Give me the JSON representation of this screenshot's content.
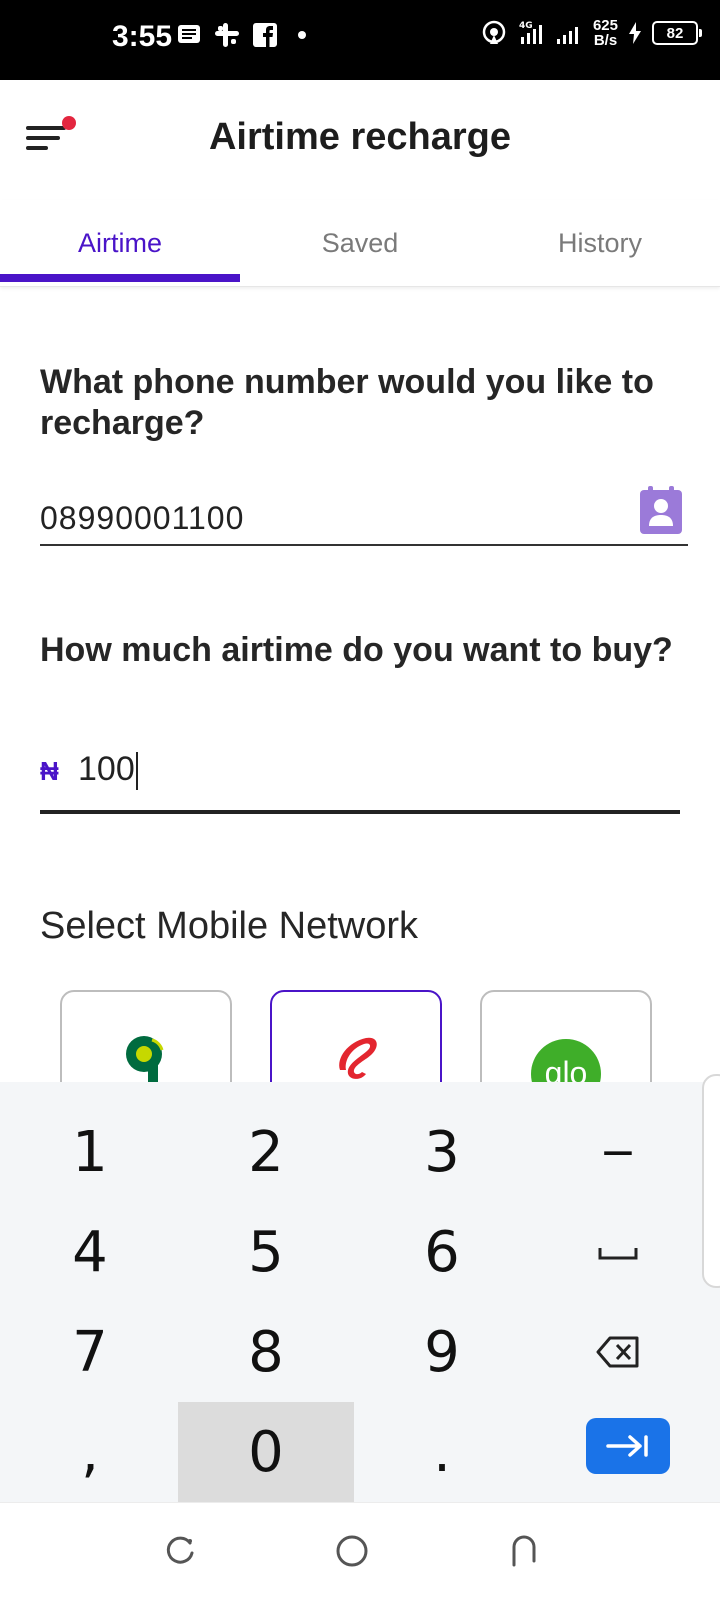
{
  "status_bar": {
    "time": "3:55",
    "network": "4G",
    "speed_value": "625",
    "speed_unit": "B/s",
    "battery": "82"
  },
  "app_bar": {
    "title": "Airtime recharge"
  },
  "tabs": [
    {
      "label": "Airtime",
      "active": true
    },
    {
      "label": "Saved",
      "active": false
    },
    {
      "label": "History",
      "active": false
    }
  ],
  "form": {
    "phone_question": "What phone number would you like to recharge?",
    "phone_value": "08990001100",
    "amount_question": "How much airtime do you want to buy?",
    "currency_symbol": "₦",
    "amount_value": "100",
    "network_label": "Select Mobile Network"
  },
  "networks": [
    {
      "name": "9mobile-logo",
      "selected": false,
      "color": "#006b3f"
    },
    {
      "name": "airtel-logo",
      "selected": true,
      "color": "#e3262f"
    },
    {
      "name": "glo-logo",
      "selected": false,
      "color": "#3fae29",
      "text": "glo"
    }
  ],
  "keyboard": {
    "rows": [
      [
        "1",
        "2",
        "3",
        "−"
      ],
      [
        "4",
        "5",
        "6",
        "␣"
      ],
      [
        "7",
        "8",
        "9",
        "⌫"
      ],
      [
        ",",
        "0",
        ".",
        "⇥"
      ]
    ]
  },
  "colors": {
    "accent": "#4a14c8",
    "badge": "#e3263f",
    "keyboard_enter": "#1a73e8"
  }
}
